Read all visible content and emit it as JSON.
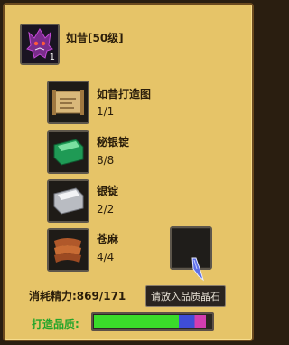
{
  "header": {
    "item_name": "如昔[50级]",
    "item_count": "1"
  },
  "materials": [
    {
      "label": "如昔打造图",
      "count": "1/1"
    },
    {
      "label": "秘银锭",
      "count": "8/8"
    },
    {
      "label": "银锭",
      "count": "2/2"
    },
    {
      "label": "苍麻",
      "count": "4/4"
    }
  ],
  "gem_slot": {
    "tooltip": "请放入品质晶石"
  },
  "energy": {
    "label": "消耗精力:869/171"
  },
  "quality": {
    "label": "打造品质:",
    "fill_percent": 95
  },
  "colors": {
    "panel": "#e6c468",
    "bar_green": "#3adb2a",
    "bar_blue": "#3f4dd6",
    "bar_pink": "#d23db0",
    "label_green": "#22a52a"
  }
}
